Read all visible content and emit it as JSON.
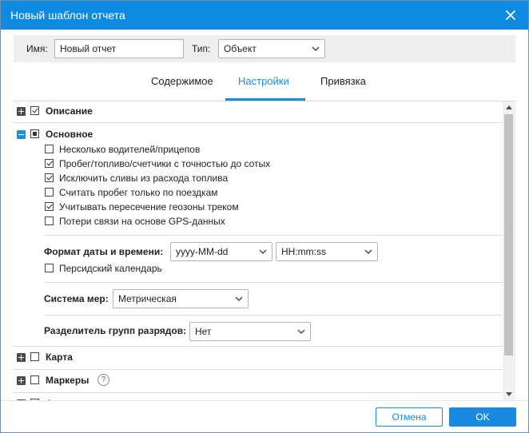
{
  "dialog": {
    "title": "Новый шаблон отчета"
  },
  "topbar": {
    "name_label": "Имя:",
    "name_value": "Новый отчет",
    "type_label": "Тип:",
    "type_value": "Объект"
  },
  "tabs": [
    {
      "label": "Содержимое"
    },
    {
      "label": "Настройки"
    },
    {
      "label": "Привязка"
    }
  ],
  "sections": {
    "description": {
      "label": "Описание",
      "checked": true
    },
    "basic": {
      "label": "Основное",
      "options": [
        {
          "label": "Несколько водителей/прицепов",
          "checked": false
        },
        {
          "label": "Пробег/топливо/счетчики с точностью до сотых",
          "checked": true
        },
        {
          "label": "Исключить сливы из расхода топлива",
          "checked": true
        },
        {
          "label": "Считать пробег только по поездкам",
          "checked": false
        },
        {
          "label": "Учитывать пересечение геозоны треком",
          "checked": true
        },
        {
          "label": "Потери связи на основе GPS-данных",
          "checked": false
        }
      ],
      "datetime_label": "Формат даты и времени:",
      "date_format": "yyyy-MM-dd",
      "time_format": "HH:mm:ss",
      "persian_calendar": "Персидский календарь",
      "units_label": "Система мер:",
      "units_value": "Метрическая",
      "separator_label": "Разделитель групп разрядов:",
      "separator_value": "Нет"
    },
    "map": {
      "label": "Карта"
    },
    "markers": {
      "label": "Маркеры"
    },
    "next": {
      "label": "А"
    }
  },
  "footer": {
    "cancel": "Отмена",
    "ok": "OK"
  },
  "colors": {
    "accent": "#1a8ae0",
    "titlebar": "#0e8be0"
  }
}
